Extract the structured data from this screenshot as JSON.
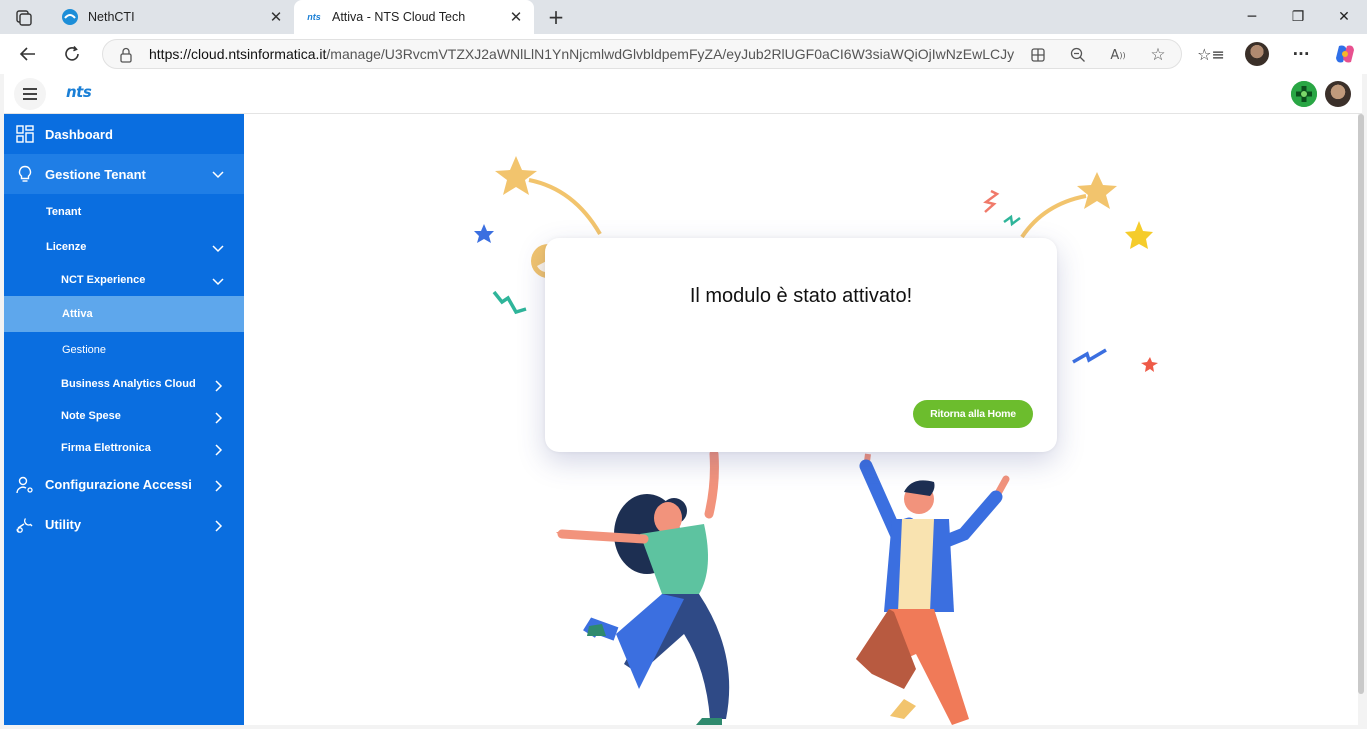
{
  "browser": {
    "tabs": [
      {
        "title": "NethCTI",
        "active": false
      },
      {
        "title": "Attiva - NTS Cloud Tech",
        "active": true
      }
    ],
    "address": {
      "url_host": "https://cloud.ntsinformatica.it",
      "url_path": "/manage/U3RvcmVTZXJ2aWNlLlN1YnNjcmlwdGlvbldpemFyZA/eyJub2RlUGF0aCI6W3siaWQiOjIwNzEwLCJyb…"
    }
  },
  "app": {
    "logo": "nts"
  },
  "sidebar": {
    "items": [
      {
        "label": "Dashboard",
        "icon": "dashboard-grid-icon"
      },
      {
        "label": "Gestione Tenant",
        "icon": "lightbulb-icon"
      },
      {
        "label": "Tenant"
      },
      {
        "label": "Licenze"
      },
      {
        "label": "NCT Experience"
      },
      {
        "label": "Attiva"
      },
      {
        "label": "Gestione"
      },
      {
        "label": "Business Analytics Cloud"
      },
      {
        "label": "Note Spese"
      },
      {
        "label": "Firma Elettronica"
      },
      {
        "label": "Configurazione Accessi",
        "icon": "user-settings-icon"
      },
      {
        "label": "Utility",
        "icon": "wrench-icon"
      }
    ]
  },
  "main": {
    "message": "Il modulo è stato attivato!",
    "home_button": "Ritorna alla Home"
  },
  "colors": {
    "sidebar": "#0a6ee0",
    "sidebar_active": "#5ea7ec",
    "button": "#6cbd2d"
  }
}
